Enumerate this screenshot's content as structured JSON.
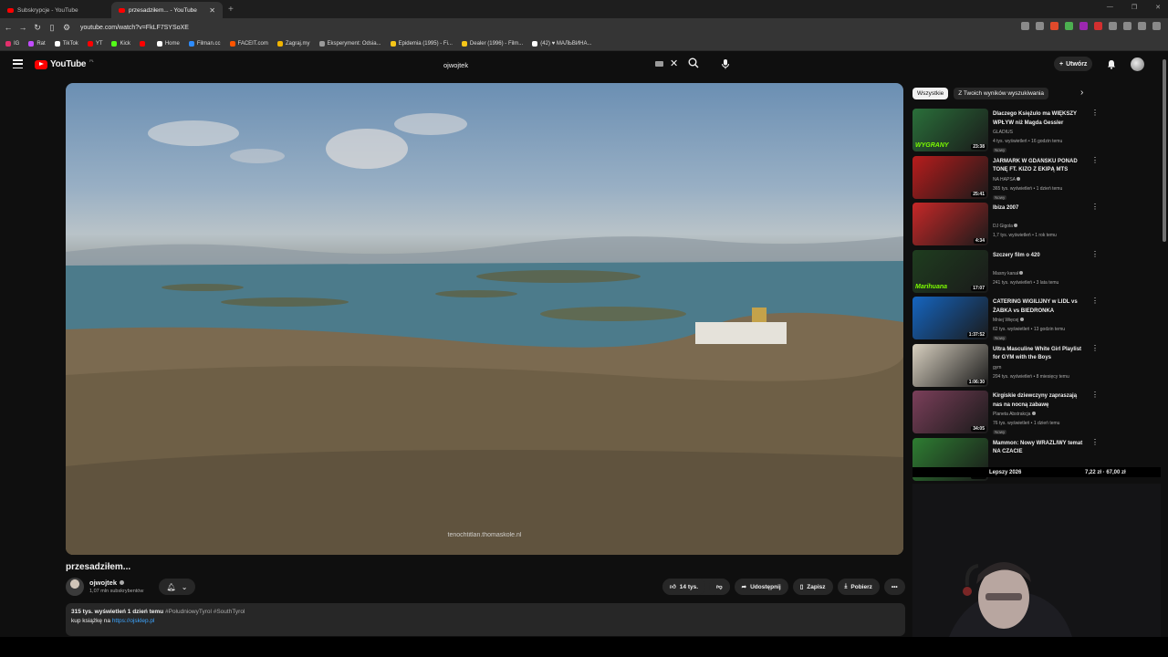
{
  "browser": {
    "tabs": [
      {
        "label": "Subskrypcje - YouTube",
        "active": false
      },
      {
        "label": "przesadziłem... - YouTube",
        "active": true
      }
    ],
    "url": "youtube.com/watch?v=FkLF7SYSoXE",
    "bookmarks": [
      {
        "label": "IG",
        "color": "#e1306c"
      },
      {
        "label": "Rat",
        "color": "#c14cff"
      },
      {
        "label": "TikTok",
        "color": "#ffffff"
      },
      {
        "label": "YT",
        "color": "#ff0000"
      },
      {
        "label": "Kick",
        "color": "#53fc18"
      },
      {
        "label": "",
        "color": "#ff0000"
      },
      {
        "label": "Home",
        "color": "#ffffff"
      },
      {
        "label": "Filman.cc",
        "color": "#2d8cff"
      },
      {
        "label": "FACEIT.com",
        "color": "#ff5500"
      },
      {
        "label": "Zagraj.my",
        "color": "#f0b400"
      },
      {
        "label": "Eksperyment: Odsia...",
        "color": "#9a9a9a"
      },
      {
        "label": "Epidemia (1995) - Fi...",
        "color": "#f5c518"
      },
      {
        "label": "Dealer (1996) - Film...",
        "color": "#f5c518"
      },
      {
        "label": "(42) ♥ МАЛЬВИНА...",
        "color": "#ffffff"
      }
    ]
  },
  "header": {
    "region": "PL",
    "logo_text": "YouTube",
    "search_value": "ojwojtek",
    "create_label": "Utwórz"
  },
  "video": {
    "title": "przesadziłem...",
    "watermark": "tenochtitlan.thomaskole.nl",
    "channel": "ojwojtek",
    "subscribers": "1,07 mln subskrybentów",
    "likes": "14 tys.",
    "share_label": "Udostępnij",
    "save_label": "Zapisz",
    "download_label": "Pobierz",
    "views_date": "315 tys. wyświetleń  1 dzień temu",
    "tags": "#PołudniowyTyrol #SouthTyrol",
    "book_text": "kup książkę na ",
    "book_link": "https://ojsklep.pl"
  },
  "sidebar": {
    "chips": [
      "Wszystkie",
      "Z Twoich wyników wyszukiwania"
    ],
    "recommendations": [
      {
        "title": "Dlaczego Księżulo ma WIĘKSZY WPŁYW niż Magda Gessler",
        "channel": "GLADIUS",
        "meta": "4 tys. wyświetleń • 16 godzin temu",
        "badge": "Nowy",
        "duration": "23:38",
        "thumb": "#2a6f3a",
        "thumb_text": "WYGRANY",
        "verified": false
      },
      {
        "title": "JARMARK W GDAŃSKU PONAD TONĘ FT. KIZO Z EKIPĄ MTS",
        "channel": "NA HAPSA",
        "meta": "365 tys. wyświetleń • 1 dzień temu",
        "badge": "Nowy",
        "duration": "25:41",
        "thumb": "#b71c1c",
        "thumb_text": "",
        "verified": true
      },
      {
        "title": "Ibiza 2007",
        "channel": "DJ Gigola",
        "meta": "1,7 tys. wyświetleń • 1 rok temu",
        "badge": "",
        "duration": "4:34",
        "thumb": "#c62828",
        "thumb_text": "",
        "verified": true
      },
      {
        "title": "Szczery film o 420",
        "channel": "Masny kanał",
        "meta": "241 tys. wyświetleń • 3 lata temu",
        "badge": "",
        "duration": "17:07",
        "thumb": "#1f3d1f",
        "thumb_text": "Marihuana",
        "verified": true
      },
      {
        "title": "CATERING WIGILIJNY w LIDL vs ŻABKA vs BIEDRONKA",
        "channel": "Mniej Więcej",
        "meta": "62 tys. wyświetleń • 13 godzin temu",
        "badge": "Nowy",
        "duration": "1:37:52",
        "thumb": "#1565c0",
        "thumb_text": "",
        "verified": true
      },
      {
        "title": "Ultra Masculine White Girl Playlist for GYM with the Boys",
        "channel": "gym",
        "meta": "204 tys. wyświetleń • 8 miesięcy temu",
        "badge": "",
        "duration": "1:06:30",
        "thumb": "#d8d0c0",
        "thumb_text": "",
        "verified": false
      },
      {
        "title": "Kirgiskie dziewczyny zapraszają nas na nocną zabawę",
        "channel": "Planeta Abstrakcja",
        "meta": "76 tys. wyświetleń • 1 dzień temu",
        "badge": "Nowy",
        "duration": "34:05",
        "thumb": "#7b3f5a",
        "thumb_text": "",
        "verified": true
      },
      {
        "title": "Mammon: Nowy WRAŻLIWY temat NA CZACIE",
        "channel": "",
        "meta": "",
        "badge": "",
        "duration": "24:42",
        "thumb": "#2e7d32",
        "thumb_text": "ZARZUTY",
        "verified": false
      }
    ]
  },
  "ticker": {
    "label": "Lepszy 2026",
    "value": "7,22 zł  ·  67,00 zł"
  }
}
